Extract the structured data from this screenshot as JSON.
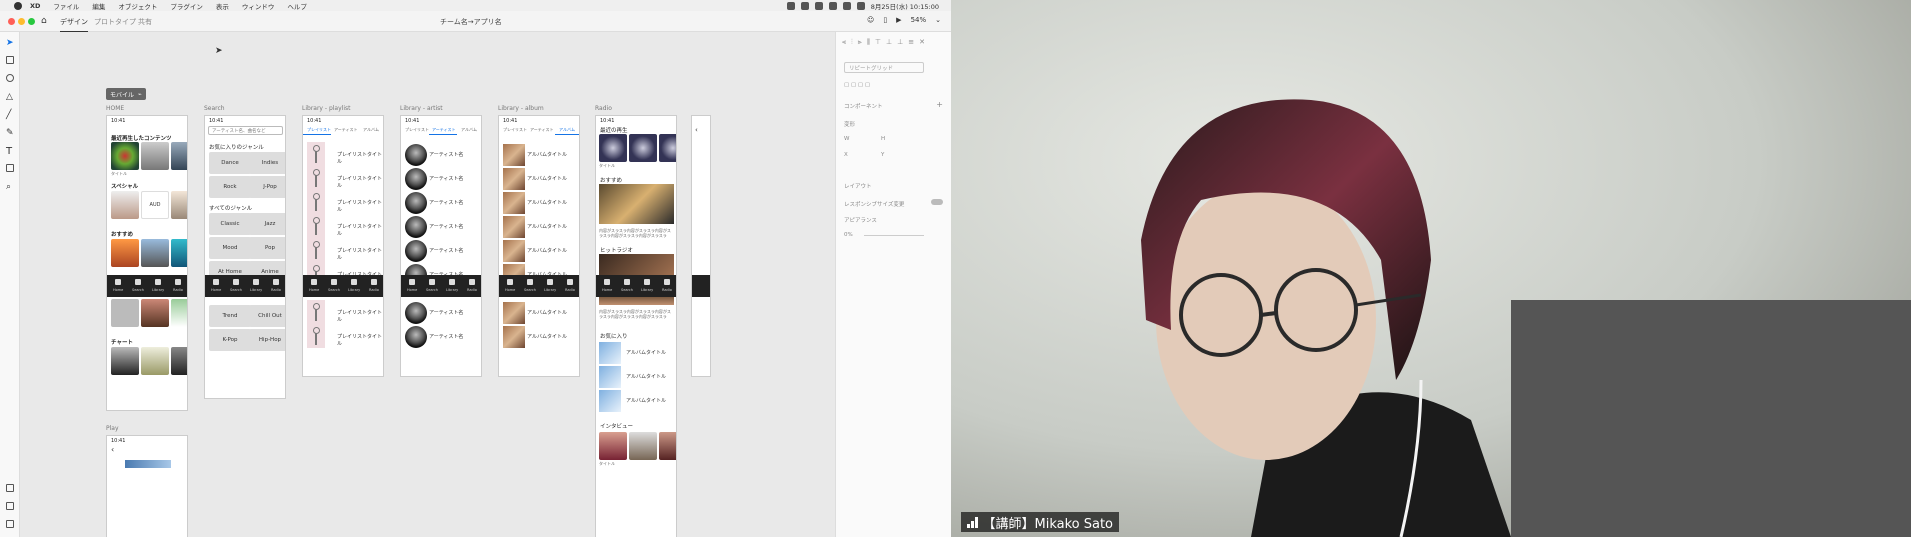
{
  "menubar": {
    "app": "XD",
    "items": [
      "ファイル",
      "編集",
      "オブジェクト",
      "プラグイン",
      "表示",
      "ウィンドウ",
      "ヘルプ"
    ],
    "datetime": "8月25日(水) 10:15:00"
  },
  "titlebar": {
    "tabs": [
      "デザイン",
      "プロトタイプ",
      "共有"
    ],
    "doc_title": "チーム名→アプリ名",
    "zoom": "54%"
  },
  "selection": {
    "label": "モバイル"
  },
  "artboards": {
    "home": {
      "label": "HOME",
      "time": "10:41",
      "sections": [
        "最近再生したコンテンツ",
        "スペシャル",
        "おすすめ",
        "チャート"
      ],
      "caption": "タイトル",
      "aud": "AUD"
    },
    "search": {
      "label": "Search",
      "time": "10:41",
      "placeholder": "アーティスト名、曲名など",
      "fav_genre": "お気に入りのジャンル",
      "all_genre": "すべてのジャンル",
      "genres": [
        "Dance",
        "Indies",
        "Rock",
        "J-Pop",
        "Classic",
        "Jazz",
        "Mood",
        "Pop",
        "At Home",
        "Anime",
        "Trend",
        "Chill Out",
        "K-Pop",
        "Hip-Hop"
      ]
    },
    "playlist": {
      "label": "Library - playlist",
      "time": "10:41",
      "tabs": [
        "プレイリスト",
        "アーティスト",
        "アルバム"
      ],
      "row": "プレイリストタイトル"
    },
    "artist": {
      "label": "Library - artist",
      "time": "10:41",
      "tabs": [
        "プレイリスト",
        "アーティスト",
        "アルバム"
      ],
      "row": "アーティスト名"
    },
    "album": {
      "label": "Library - album",
      "time": "10:41",
      "tabs": [
        "プレイリスト",
        "アーティスト",
        "アルバム"
      ],
      "row": "アルバムタイトル"
    },
    "radio": {
      "label": "Radio",
      "time": "10:41",
      "sections": [
        "最近の再生",
        "おすすめ",
        "ヒットラジオ",
        "お気に入り",
        "インタビュー"
      ],
      "text": "内容がスラスラ内容がスラスラ内容がスラスラ内容がスラスラ内容がスラスラ",
      "row": "アルバムタイトル",
      "caption": "タイトル"
    },
    "play": {
      "label": "Play",
      "time": "10:41"
    }
  },
  "nav_labels": [
    "Home",
    "Search",
    "Library",
    "Radio"
  ],
  "panel": {
    "repeat_grid": "リピートグリッド",
    "component": "コンポーネント",
    "transform": "変形",
    "w": "W",
    "h": "H",
    "x": "X",
    "y": "Y",
    "layout": "レイアウト",
    "responsive": "レスポンシブサイズ変更",
    "appearance": "アピアランス",
    "opacity": "0%"
  },
  "video": {
    "name": "【講師】Mikako Sato"
  }
}
